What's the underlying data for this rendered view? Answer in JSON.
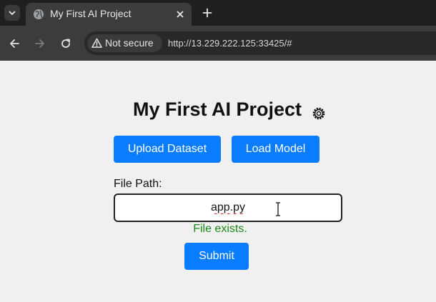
{
  "browser": {
    "tab": {
      "title": "My First AI Project"
    },
    "address": {
      "security_label": "Not secure",
      "url": "http://13.229.222.125:33425/#"
    },
    "icons": {
      "tab_list": "chevron-down-icon",
      "favicon": "globe-icon",
      "close": "close-icon",
      "new_tab": "plus-icon",
      "back": "arrow-left-icon",
      "forward": "arrow-right-icon",
      "reload": "reload-icon",
      "security": "warning-triangle-icon"
    }
  },
  "page": {
    "title": "My First AI Project",
    "settings_icon": "gear-icon",
    "buttons": {
      "upload": "Upload Dataset",
      "load": "Load Model",
      "submit": "Submit"
    },
    "file_path": {
      "label": "File Path:",
      "value": "app.py",
      "status": "File exists."
    }
  },
  "colors": {
    "accent": "#0a7cff",
    "success": "#1a8a1a",
    "chrome_dark": "#1f1f1f",
    "chrome_toolbar": "#3c3c3c",
    "page_bg": "#f0f0f0"
  }
}
